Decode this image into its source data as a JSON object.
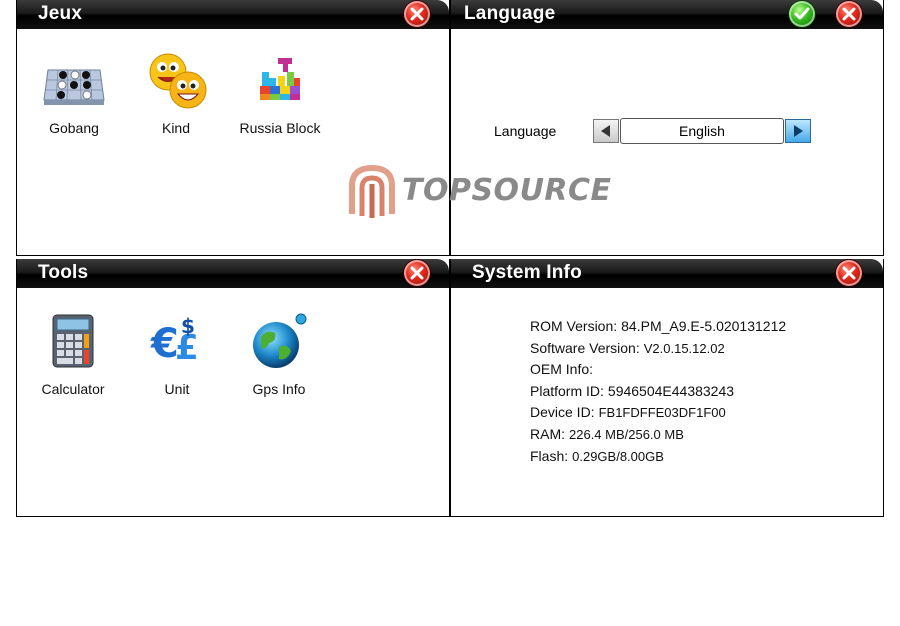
{
  "panels": {
    "games": {
      "title": "Jeux",
      "close_icon": "close-icon",
      "apps": [
        {
          "label": "Gobang",
          "icon": "gobang-board-icon"
        },
        {
          "label": "Kind",
          "icon": "smiley-faces-icon"
        },
        {
          "label": "Russia Block",
          "icon": "tetris-blocks-icon"
        }
      ]
    },
    "language": {
      "title": "Language",
      "confirm_icon": "check-icon",
      "close_icon": "close-icon",
      "field_label": "Language",
      "selected": "English",
      "prev_icon": "arrow-left-icon",
      "next_icon": "arrow-right-icon"
    },
    "tools": {
      "title": "Tools",
      "close_icon": "close-icon",
      "apps": [
        {
          "label": "Calculator",
          "icon": "calculator-icon"
        },
        {
          "label": "Unit",
          "icon": "currency-unit-icon"
        },
        {
          "label": "Gps Info",
          "icon": "globe-icon"
        }
      ]
    },
    "system": {
      "title": "System Info",
      "close_icon": "close-icon",
      "rows": [
        {
          "key": "ROM Version:",
          "value": "84.PM_A9.E-5.020131212"
        },
        {
          "key": "Software Version:",
          "value": "V2.0.15.12.02"
        },
        {
          "key": "OEM Info:",
          "value": ""
        },
        {
          "key": "Platform ID:",
          "value": "5946504E44383243"
        },
        {
          "key": "Device ID:",
          "value": "FB1FDFFE03DF1F00"
        },
        {
          "key": "RAM:",
          "value": "226.4 MB/256.0 MB"
        },
        {
          "key": "Flash:",
          "value": "0.29GB/8.00GB"
        }
      ]
    }
  },
  "watermark": {
    "text": "TOPSOURCE"
  },
  "colors": {
    "titlebar": "#000000",
    "close": "#d9261a",
    "ok": "#2eaa1c",
    "accent_button": "#47a9e8",
    "watermark": "#8a8a8a"
  }
}
